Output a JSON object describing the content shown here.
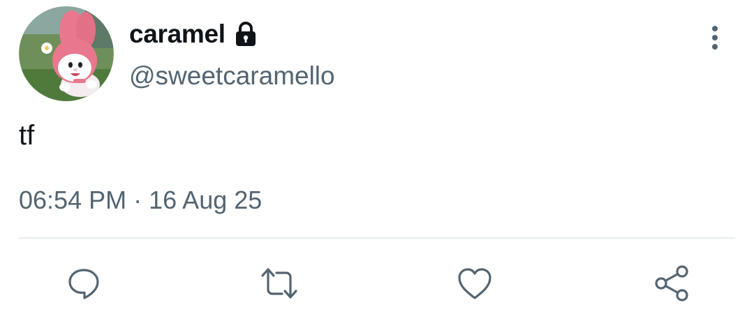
{
  "tweet": {
    "author": {
      "display_name": "caramel",
      "handle": "@sweetcaramello",
      "avatar_icon": "my-melody-avatar",
      "protected_icon": "lock-icon"
    },
    "text": "tf",
    "time": "06:54 PM",
    "separator": "·",
    "date": "16 Aug 25"
  },
  "actions": [
    {
      "name": "reply",
      "icon": "speech-bubble-icon"
    },
    {
      "name": "retweet",
      "icon": "retweet-icon"
    },
    {
      "name": "like",
      "icon": "heart-icon"
    },
    {
      "name": "share",
      "icon": "share-icon"
    }
  ],
  "menu_icon": "more-vertical-icon",
  "colors": {
    "text_primary": "#0f1419",
    "text_secondary": "#536471",
    "icon": "#536471",
    "divider": "#e6ecf0"
  }
}
